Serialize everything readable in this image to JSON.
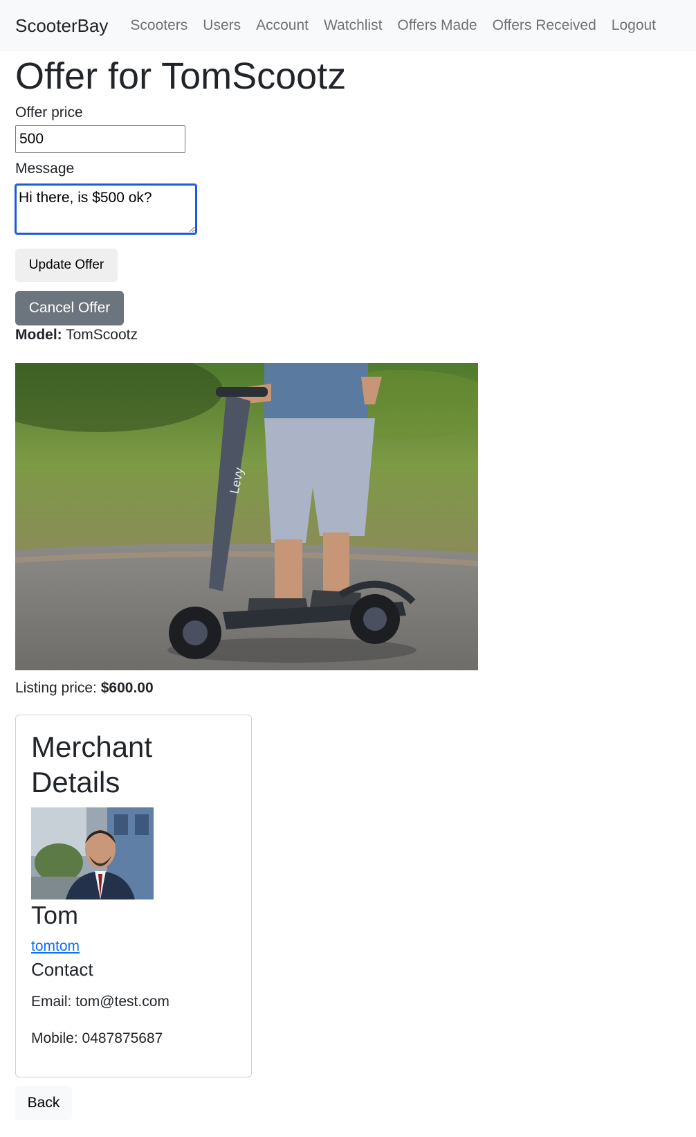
{
  "navbar": {
    "brand": "ScooterBay",
    "links": [
      "Scooters",
      "Users",
      "Account",
      "Watchlist",
      "Offers Made",
      "Offers Received",
      "Logout"
    ]
  },
  "page": {
    "title": "Offer for TomScootz"
  },
  "form": {
    "offer_price_label": "Offer price",
    "offer_price_value": "500",
    "message_label": "Message",
    "message_value": "Hi there, is $500 ok?",
    "update_button": "Update Offer",
    "cancel_button": "Cancel Offer"
  },
  "scooter": {
    "model_label": "Model:",
    "model_value": "TomScootz",
    "brand_on_stem": "Levy",
    "listing_label": "Listing price:",
    "listing_value": "$600.00"
  },
  "merchant": {
    "card_title_line1": "Merchant",
    "card_title_line2": "Details",
    "name": "Tom",
    "username": "tomtom",
    "contact_heading": "Contact",
    "email_label": "Email:",
    "email_value": "tom@test.com",
    "mobile_label": "Mobile:",
    "mobile_value": "0487875687"
  },
  "back_button": "Back",
  "colors": {
    "navbar_bg": "#f8f9fa",
    "cancel_button_bg": "#6c757d",
    "link": "#0d6efd",
    "focus_border": "#1c5bd6"
  }
}
